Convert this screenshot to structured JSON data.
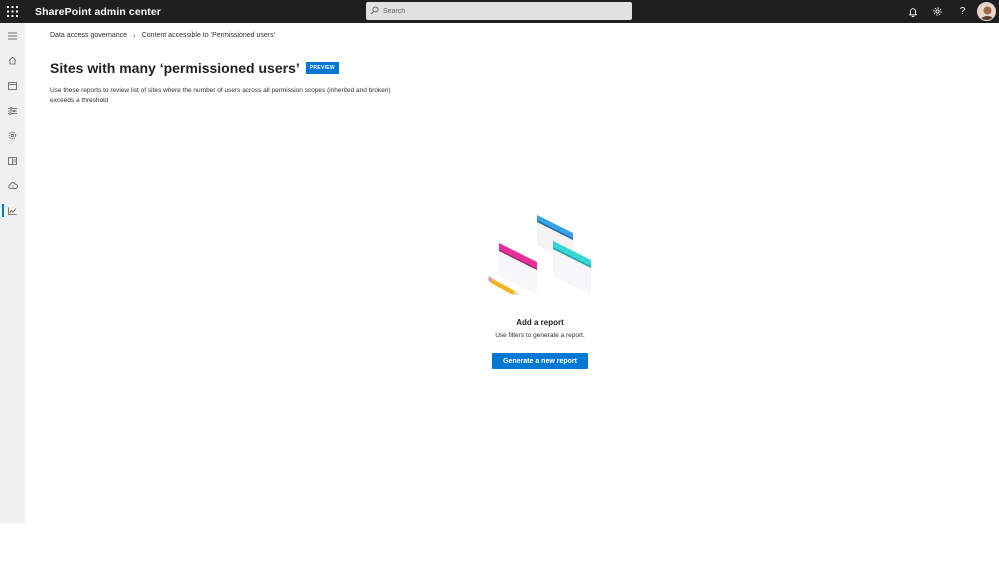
{
  "header": {
    "app_title": "SharePoint admin center",
    "search_placeholder": "Search",
    "icons": [
      "waffle-icon",
      "search-icon",
      "bell-icon",
      "gear-icon",
      "help-icon",
      "avatar"
    ],
    "help_glyph": "?"
  },
  "sidenav": {
    "items": [
      {
        "icon": "hamburger-icon"
      },
      {
        "icon": "home-icon"
      },
      {
        "icon": "sites-icon"
      },
      {
        "icon": "policies-icon"
      },
      {
        "icon": "settings-icon"
      },
      {
        "icon": "content-services-icon"
      },
      {
        "icon": "migration-icon"
      },
      {
        "icon": "reports-icon",
        "active": true
      }
    ]
  },
  "breadcrumb": {
    "items": [
      "Data access governance",
      "Content accessible to ‘Permissioned users’"
    ],
    "separator": "›"
  },
  "page": {
    "title": "Sites with many ‘permissioned users’",
    "badge": "PREVIEW",
    "description": "Use these reports to review list of sites where the number of users across all permission scopes (inherited and broken) exceeds a threshold"
  },
  "empty_state": {
    "title": "Add a report",
    "subtitle": "Use filters to generate a report.",
    "button_label": "Generate a new report"
  },
  "colors": {
    "topbar": "#1f1f1f",
    "accent": "#0078d4",
    "sidenav": "#f0f0f0",
    "card_pink": "#e62f9b",
    "card_cyan": "#35d6d6",
    "card_blue": "#3aa0e8",
    "pencil": "#f2b51d"
  }
}
